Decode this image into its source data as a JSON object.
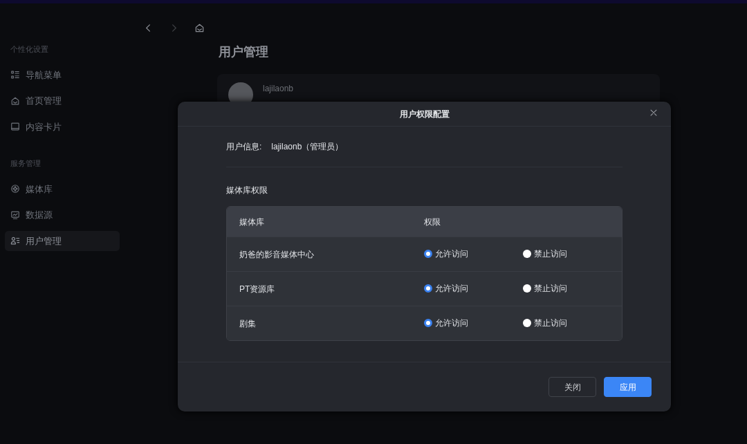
{
  "sidebar": {
    "sections": [
      {
        "title": "个性化设置",
        "items": [
          {
            "label": "导航菜单",
            "selected": false
          },
          {
            "label": "首页管理",
            "selected": false
          },
          {
            "label": "内容卡片",
            "selected": false
          }
        ]
      },
      {
        "title": "服务管理",
        "items": [
          {
            "label": "媒体库",
            "selected": false
          },
          {
            "label": "数据源",
            "selected": false
          },
          {
            "label": "用户管理",
            "selected": true
          }
        ]
      }
    ]
  },
  "page": {
    "title": "用户管理",
    "user_card": {
      "name": "lajilaonb"
    }
  },
  "dialog": {
    "title": "用户权限配置",
    "user_info": {
      "label": "用户信息:",
      "value": "lajilaonb（管理员）"
    },
    "section_title": "媒体库权限",
    "table": {
      "columns": [
        "媒体库",
        "权限"
      ],
      "rows": [
        {
          "name": "奶爸的影音媒体中心",
          "options": [
            {
              "label": "允许访问",
              "selected": true
            },
            {
              "label": "禁止访问",
              "selected": false
            }
          ]
        },
        {
          "name": "PT资源库",
          "options": [
            {
              "label": "允许访问",
              "selected": true
            },
            {
              "label": "禁止访问",
              "selected": false
            }
          ]
        },
        {
          "name": "剧集",
          "options": [
            {
              "label": "允许访问",
              "selected": true
            },
            {
              "label": "禁止访问",
              "selected": false
            }
          ]
        }
      ]
    },
    "buttons": [
      {
        "label": "关闭",
        "kind": "secondary"
      },
      {
        "label": "应用",
        "kind": "primary"
      }
    ]
  }
}
